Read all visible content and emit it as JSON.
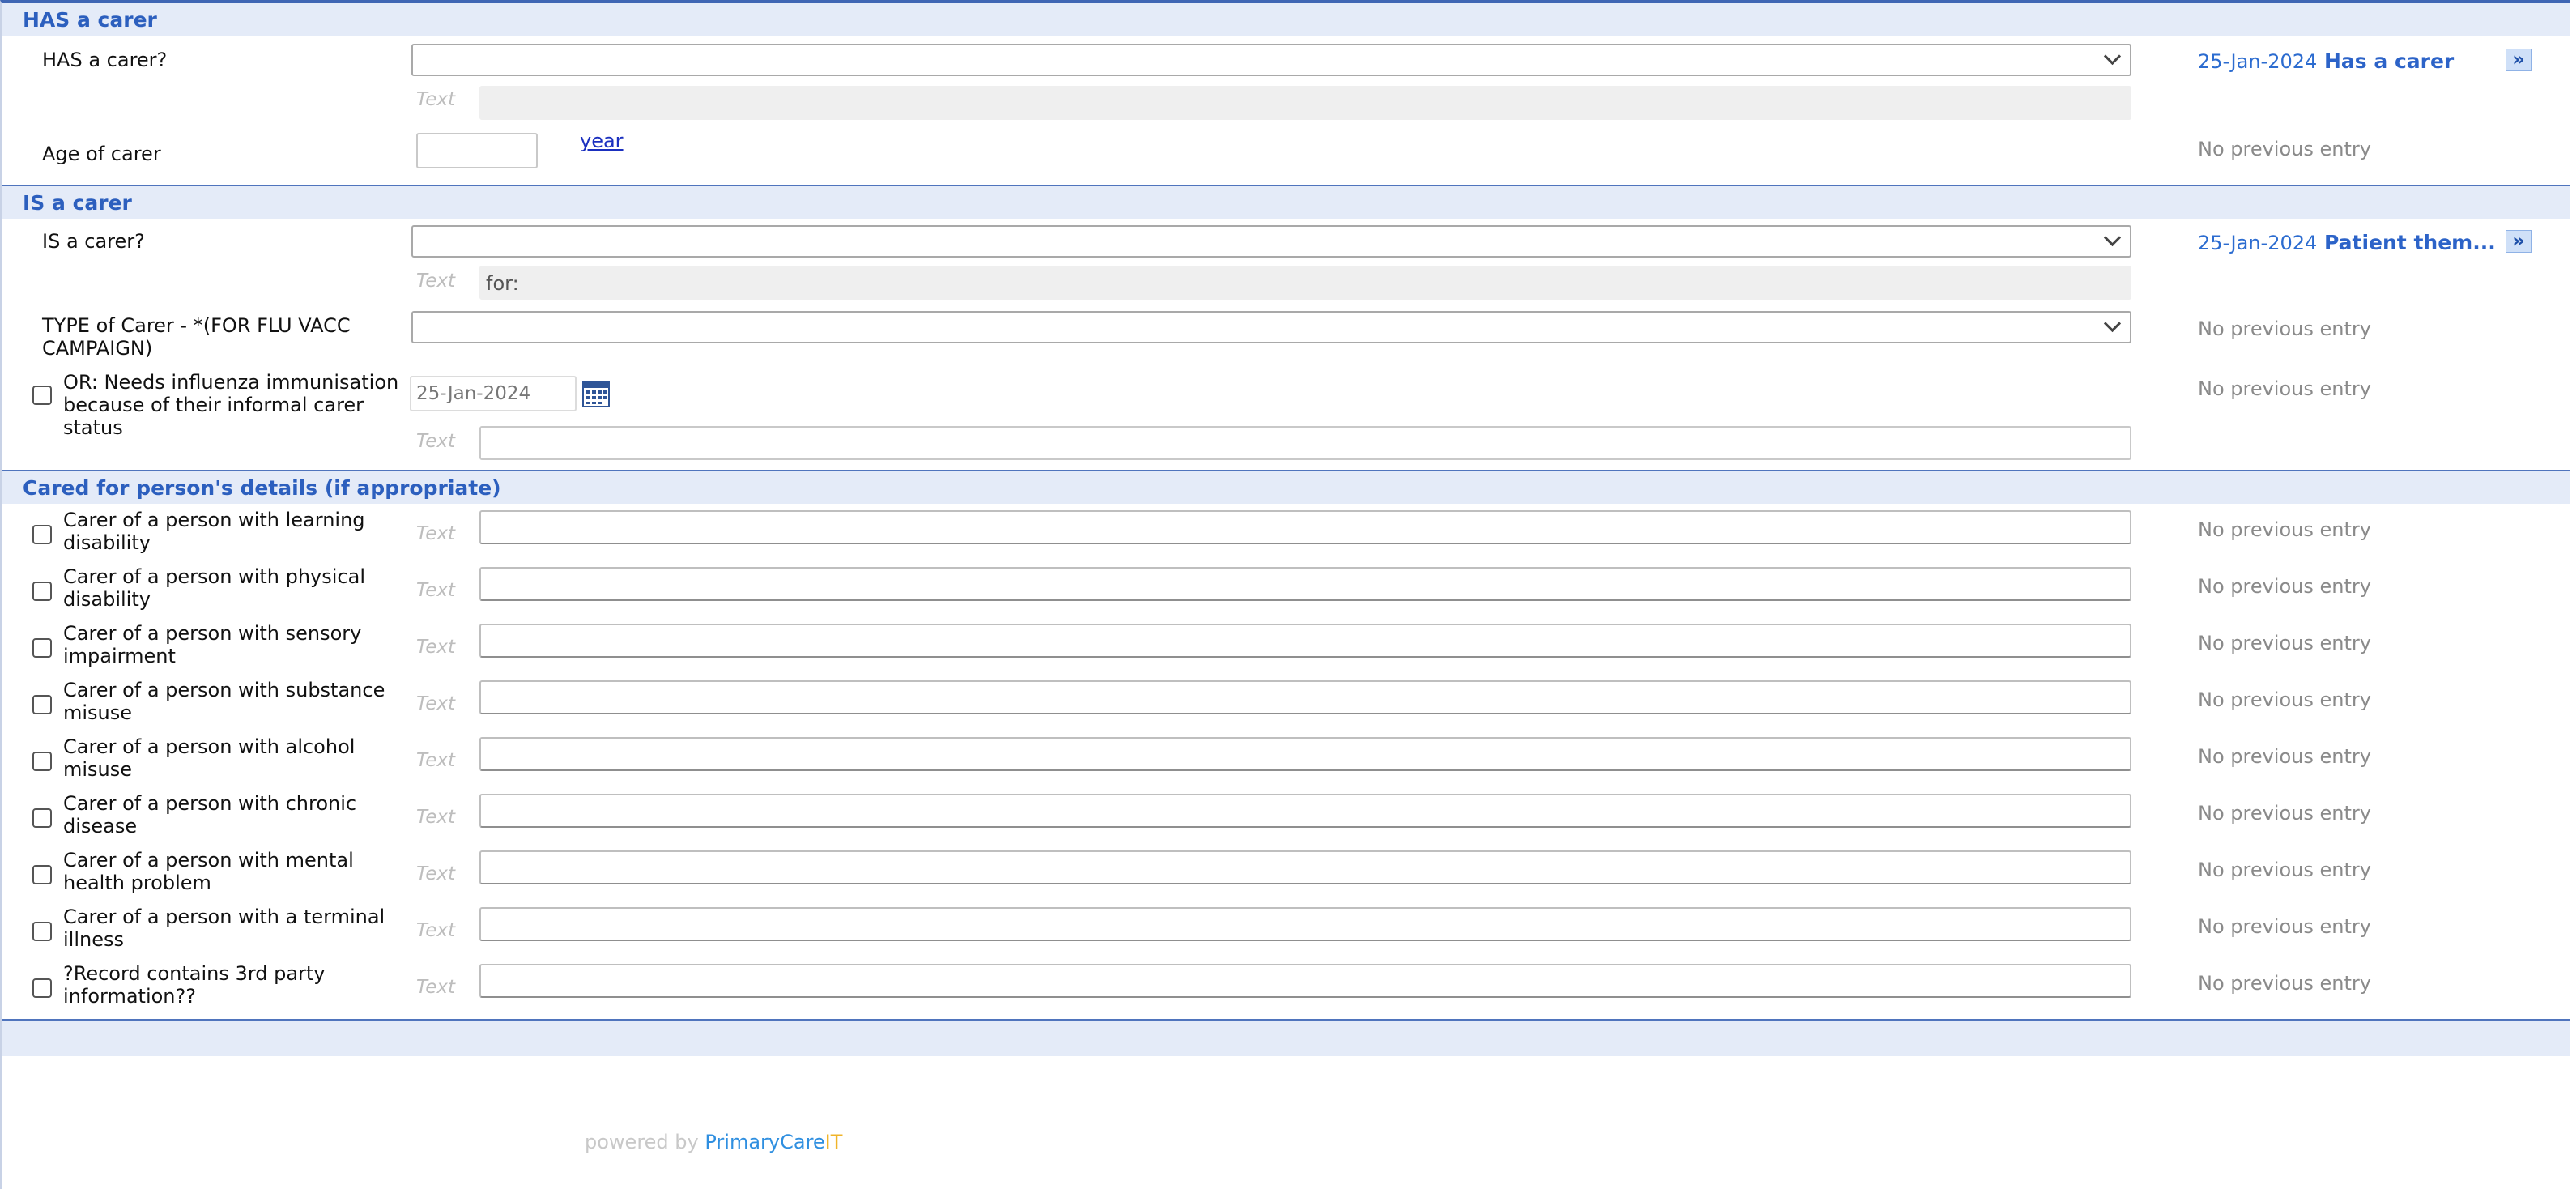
{
  "has_carer": {
    "section_title": "HAS a carer",
    "question_label": "HAS a carer?",
    "text_hint": "Text",
    "prev_date": "25-Jan-2024",
    "prev_term": "Has a carer",
    "age_label": "Age of carer",
    "age_unit_link": "year",
    "age_prev": "No previous entry",
    "arrow": "»"
  },
  "is_carer": {
    "section_title": "IS a carer",
    "question_label": "IS a carer?",
    "text_hint": "Text",
    "text_value": "for:",
    "prev_date": "25-Jan-2024",
    "prev_term": "Patient them...",
    "type_label": "TYPE of Carer - *(FOR FLU VACC CAMPAIGN)",
    "type_prev": "No previous entry",
    "flu_label": "OR: Needs influenza immunisation because of their informal carer status",
    "flu_date": "25-Jan-2024",
    "flu_prev": "No previous entry",
    "arrow": "»"
  },
  "cared_for": {
    "section_title": "Cared for person's details (if appropriate)",
    "text_hint": "Text",
    "items": [
      {
        "label": "Carer of a person with learning disability",
        "prev": "No previous entry"
      },
      {
        "label": "Carer of a person with physical disability",
        "prev": "No previous entry"
      },
      {
        "label": "Carer of a person with sensory impairment",
        "prev": "No previous entry"
      },
      {
        "label": "Carer of a person with substance misuse",
        "prev": "No previous entry"
      },
      {
        "label": "Carer of a person with alcohol misuse",
        "prev": "No previous entry"
      },
      {
        "label": "Carer of a person with chronic disease",
        "prev": "No previous entry"
      },
      {
        "label": "Carer of a person with mental health problem",
        "prev": "No previous entry"
      },
      {
        "label": "Carer of a person with a terminal illness",
        "prev": "No previous entry"
      },
      {
        "label": "?Record contains 3rd party information??",
        "prev": "No previous entry"
      }
    ]
  },
  "footer": {
    "powered_by": "powered by",
    "brand_main": "PrimaryCare",
    "brand_accent": "IT"
  },
  "colors": {
    "accent": "#2c5fbe",
    "section_bg": "#e4ebf8",
    "prev_muted": "#8a8a8a",
    "brand_blue": "#2f8fe0",
    "brand_orange": "#f0b429"
  }
}
